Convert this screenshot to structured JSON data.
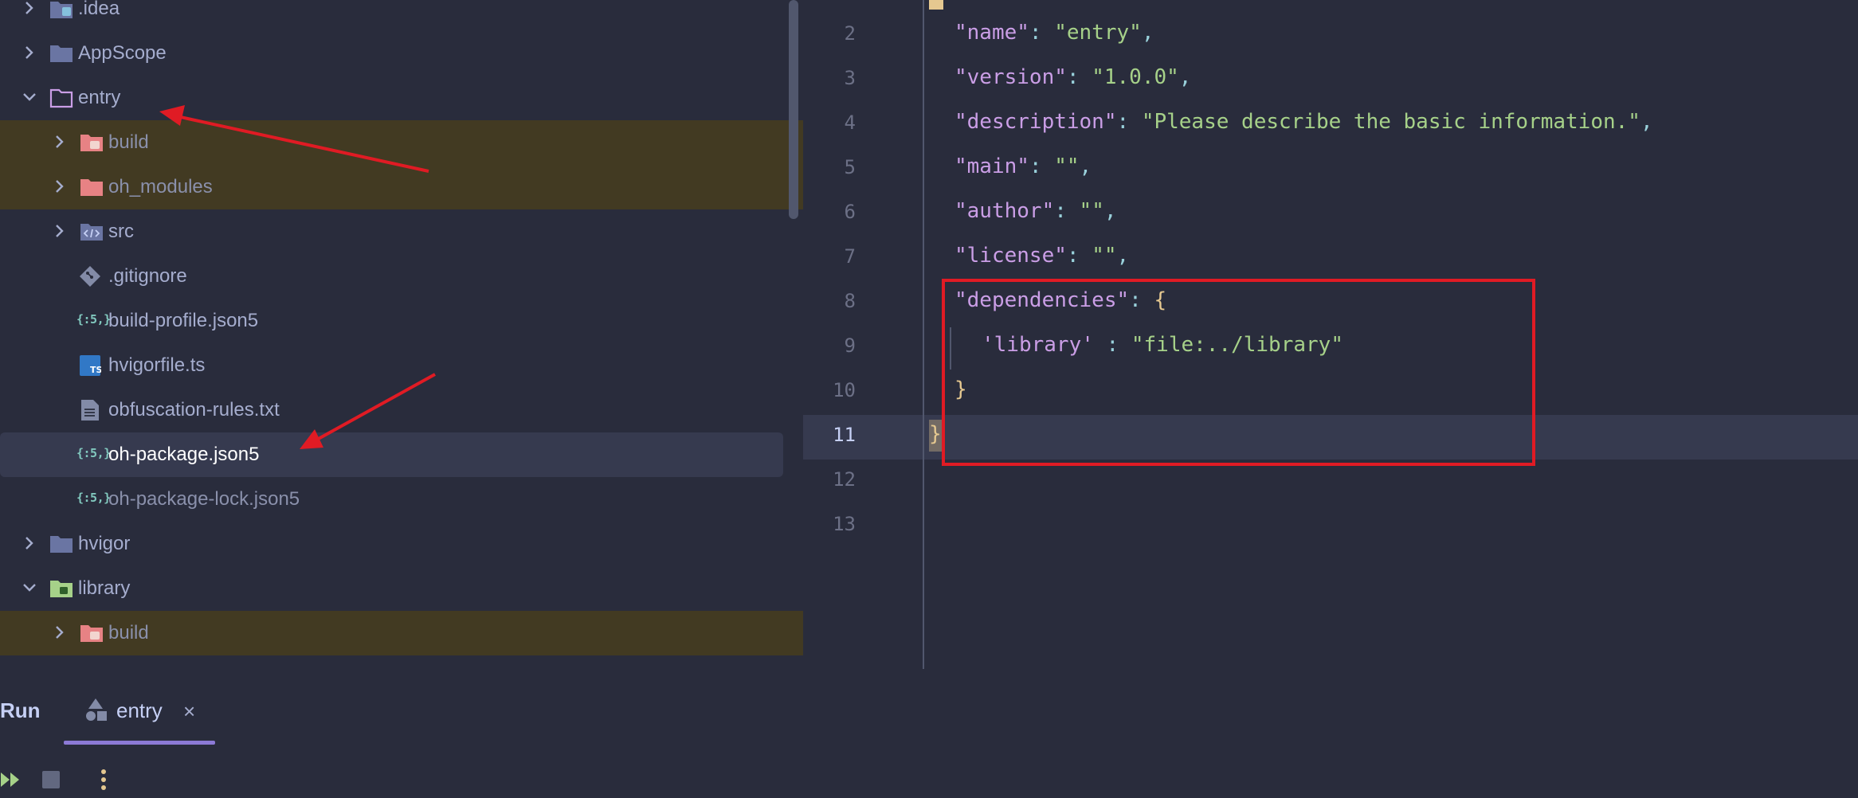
{
  "tree": {
    "items": [
      {
        "label": ".idea"
      },
      {
        "label": "AppScope"
      },
      {
        "label": "entry"
      },
      {
        "label": "build"
      },
      {
        "label": "oh_modules"
      },
      {
        "label": "src"
      },
      {
        "label": ".gitignore"
      },
      {
        "label": "build-profile.json5",
        "badge": "{:5,}"
      },
      {
        "label": "hvigorfile.ts"
      },
      {
        "label": "obfuscation-rules.txt"
      },
      {
        "label": "oh-package.json5",
        "badge": "{:5,}"
      },
      {
        "label": "oh-package-lock.json5",
        "badge": "{:5,}"
      },
      {
        "label": "hvigor"
      },
      {
        "label": "library"
      },
      {
        "label": "build"
      }
    ]
  },
  "editor": {
    "line_numbers": [
      "2",
      "3",
      "4",
      "5",
      "6",
      "7",
      "8",
      "9",
      "10",
      "11",
      "12",
      "13"
    ],
    "lines": [
      {
        "key": "\"name\"",
        "value": "\"entry\""
      },
      {
        "key": "\"version\"",
        "value": "\"1.0.0\""
      },
      {
        "key": "\"description\"",
        "value": "\"Please describe the basic information.\""
      },
      {
        "key": "\"main\"",
        "value": "\"\""
      },
      {
        "key": "\"author\"",
        "value": "\"\""
      },
      {
        "key": "\"license\"",
        "value": "\"\""
      },
      {
        "key": "\"dependencies\"",
        "open": "{"
      },
      {
        "key": "'library'",
        "value": "\"file:../library\""
      },
      {
        "close": "}"
      },
      {
        "close": "}"
      }
    ]
  },
  "run_panel": {
    "title": "Run",
    "tab_label": "entry",
    "tab_close": "×"
  },
  "colors": {
    "background": "#292c3c",
    "ignored_row": "#423a22",
    "selection": "#363a4f",
    "annotation_red": "#e01b24",
    "string": "#a6d189",
    "key": "#ca9ee6",
    "accent": "#8c7ad6"
  }
}
